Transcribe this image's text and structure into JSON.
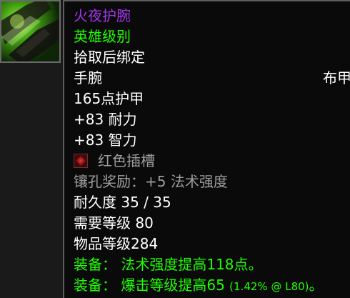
{
  "item": {
    "name": "火夜护腕",
    "quality": "英雄级别",
    "binding": "拾取后绑定",
    "slot": "手腕",
    "armor_type": "布甲",
    "armor": "165点护甲",
    "stamina": "+83 耐力",
    "intellect": "+83 智力",
    "socket_label": "红色插槽",
    "socket_bonus": "镶孔奖励：+5 法术强度",
    "durability": "耐久度 35 / 35",
    "required_level": "需要等级 80",
    "item_level": "物品等级284",
    "equip1": "装备：  法术强度提高118点。",
    "equip2_prefix": "装备：  爆击等级提高65",
    "equip2_detail": "(1.42% @ L80)",
    "equip2_end": "。"
  },
  "colors": {
    "epic": "#a335ee",
    "heroic": "#1eff00",
    "green": "#1eff00",
    "gray": "#9d9d9d",
    "white": "#ffffff"
  },
  "icons": {
    "item_icon": "bracer-icon",
    "socket_icon": "red-socket-icon"
  }
}
